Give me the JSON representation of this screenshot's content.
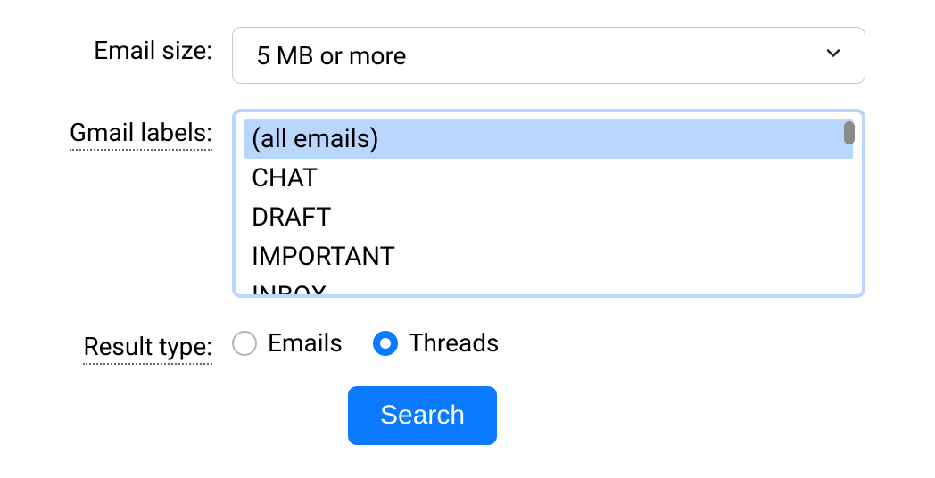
{
  "emailSize": {
    "label": "Email size:",
    "selected": "5 MB or more"
  },
  "gmailLabels": {
    "label": "Gmail labels:",
    "options": [
      {
        "text": "(all emails)",
        "selected": true
      },
      {
        "text": "CHAT",
        "selected": false
      },
      {
        "text": "DRAFT",
        "selected": false
      },
      {
        "text": "IMPORTANT",
        "selected": false
      },
      {
        "text": "INBOX",
        "selected": false
      }
    ]
  },
  "resultType": {
    "label": "Result type:",
    "options": [
      {
        "text": "Emails",
        "checked": false
      },
      {
        "text": "Threads",
        "checked": true
      }
    ]
  },
  "searchButton": {
    "label": "Search"
  },
  "colors": {
    "accent": "#0a7aff",
    "selectionBg": "#b9d6ff"
  }
}
